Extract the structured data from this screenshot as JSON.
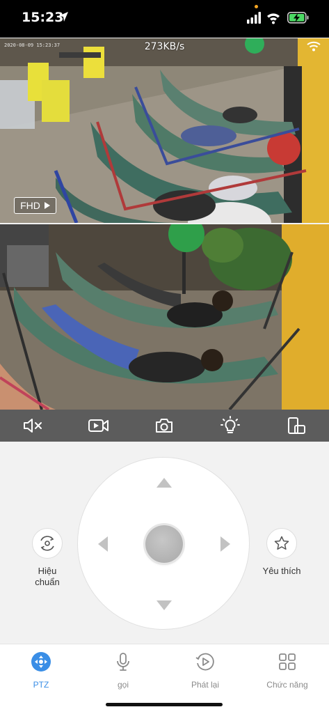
{
  "status_bar": {
    "time": "15:23"
  },
  "stream": {
    "bitrate": "273KB/s",
    "timestamp": "2020-08-09 15:23:37",
    "quality_button": "FHD"
  },
  "toolbar": {
    "items": [
      {
        "icon": "speaker-mute-icon"
      },
      {
        "icon": "video-record-icon"
      },
      {
        "icon": "camera-icon"
      },
      {
        "icon": "light-bulb-icon"
      },
      {
        "icon": "phone-rotate-icon"
      }
    ]
  },
  "ptz": {
    "calibrate_label": "Hiệu\nchuẩn",
    "favorite_label": "Yêu thích"
  },
  "tabs": [
    {
      "label": "PTZ",
      "icon": "ptz-icon",
      "active": true
    },
    {
      "label": "gọi",
      "icon": "microphone-icon",
      "active": false
    },
    {
      "label": "Phát lại",
      "icon": "playback-icon",
      "active": false
    },
    {
      "label": "Chức năng",
      "icon": "grid-icon",
      "active": false
    }
  ],
  "colors": {
    "accent": "#3a8ee6",
    "toolbar_bg": "#5c5c5c",
    "battery_green": "#4cd964"
  }
}
